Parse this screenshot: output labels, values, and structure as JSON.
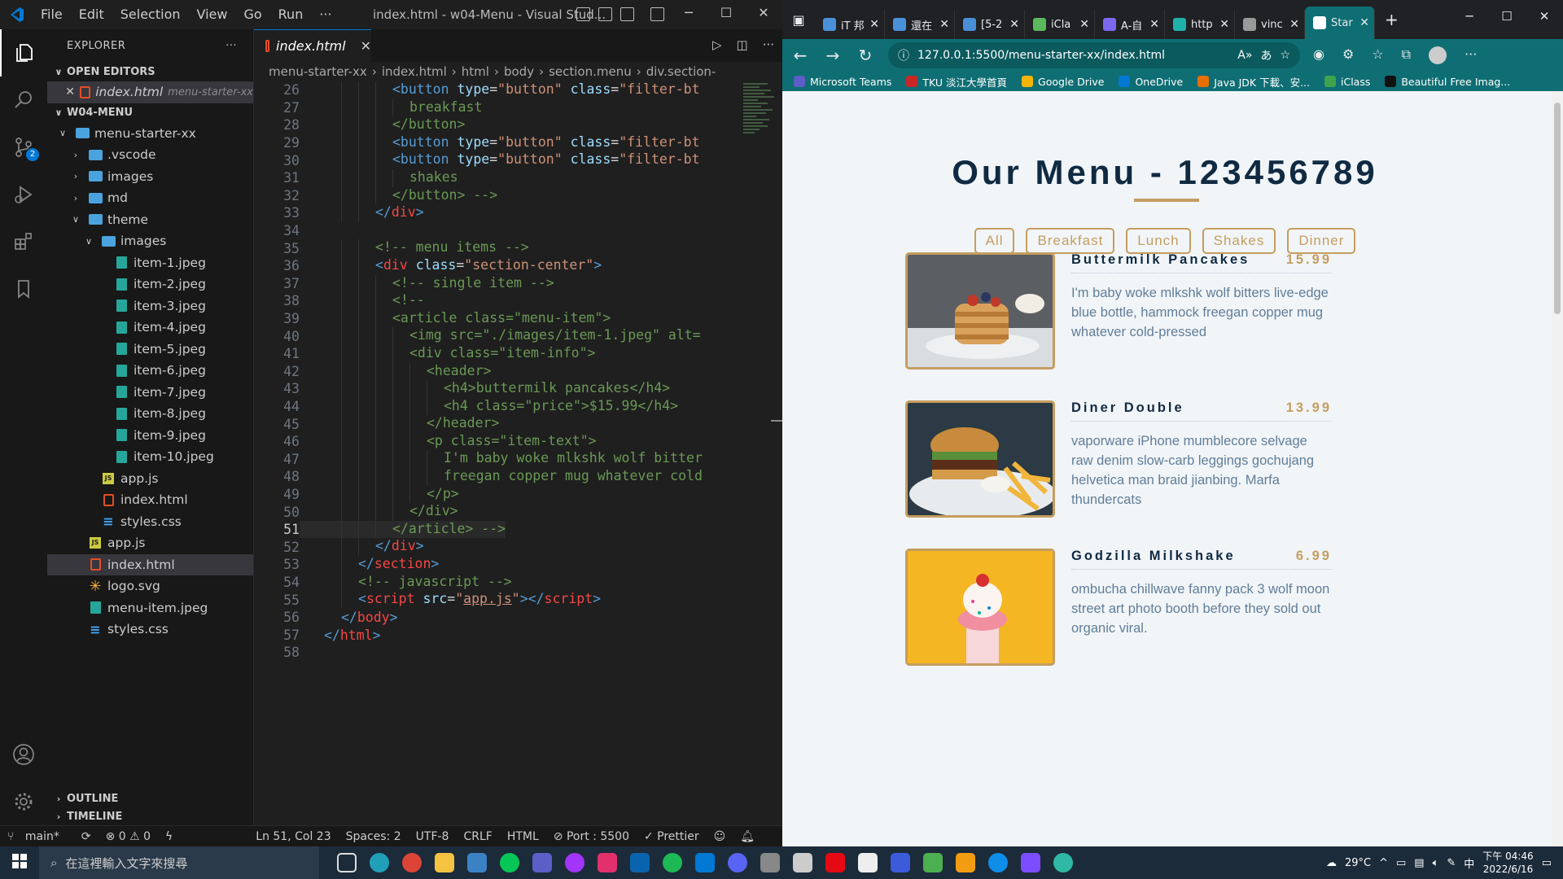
{
  "vscode": {
    "menu": [
      "File",
      "Edit",
      "Selection",
      "View",
      "Go",
      "Run",
      "···"
    ],
    "window_title": "index.html - w04-Menu - Visual Stud...",
    "explorer_title": "EXPLORER",
    "explorer_more": "···",
    "source_control_badge": "2",
    "open_editors_label": "OPEN EDITORS",
    "open_editor": {
      "name": "index.html",
      "path": "menu-starter-xx"
    },
    "workspace_label": "W04-MENU",
    "tree": [
      {
        "label": "menu-starter-xx",
        "type": "folder-open",
        "depth": 1
      },
      {
        "label": ".vscode",
        "type": "folder",
        "depth": 2
      },
      {
        "label": "images",
        "type": "folder",
        "depth": 2
      },
      {
        "label": "md",
        "type": "folder",
        "depth": 2
      },
      {
        "label": "theme",
        "type": "folder-open",
        "depth": 2
      },
      {
        "label": "images",
        "type": "folder-open",
        "depth": 3
      },
      {
        "label": "item-1.jpeg",
        "type": "image",
        "depth": 4
      },
      {
        "label": "item-2.jpeg",
        "type": "image",
        "depth": 4
      },
      {
        "label": "item-3.jpeg",
        "type": "image",
        "depth": 4
      },
      {
        "label": "item-4.jpeg",
        "type": "image",
        "depth": 4
      },
      {
        "label": "item-5.jpeg",
        "type": "image",
        "depth": 4
      },
      {
        "label": "item-6.jpeg",
        "type": "image",
        "depth": 4
      },
      {
        "label": "item-7.jpeg",
        "type": "image",
        "depth": 4
      },
      {
        "label": "item-8.jpeg",
        "type": "image",
        "depth": 4
      },
      {
        "label": "item-9.jpeg",
        "type": "image",
        "depth": 4
      },
      {
        "label": "item-10.jpeg",
        "type": "image",
        "depth": 4
      },
      {
        "label": "app.js",
        "type": "js",
        "depth": 3
      },
      {
        "label": "index.html",
        "type": "html",
        "depth": 3
      },
      {
        "label": "styles.css",
        "type": "css",
        "depth": 3
      },
      {
        "label": "app.js",
        "type": "js",
        "depth": 2
      },
      {
        "label": "index.html",
        "type": "html",
        "depth": 2,
        "selected": true
      },
      {
        "label": "logo.svg",
        "type": "svg",
        "depth": 2
      },
      {
        "label": "menu-item.jpeg",
        "type": "image",
        "depth": 2
      },
      {
        "label": "styles.css",
        "type": "css",
        "depth": 2
      }
    ],
    "outline_label": "OUTLINE",
    "timeline_label": "TIMELINE",
    "tab_label": "index.html",
    "breadcrumb": [
      "menu-starter-xx",
      "index.html",
      "html",
      "body",
      "section.menu",
      "div.section-"
    ],
    "current_line": 51,
    "code_lines": [
      {
        "n": 26,
        "html": "<span class='ind-c'></span><span class='ind'></span><span class='ind'></span><span class='ind'></span><span class='tg'>&lt;button</span> <span class='at'>type</span>=<span class='st'>\"button\"</span> <span class='at'>class</span>=<span class='st'>\"filter-bt</span>"
      },
      {
        "n": 27,
        "html": "<span class='ind-c'></span><span class='ind'></span><span class='ind'></span><span class='ind'></span><span class='ind'></span><span class='cm'>breakfast</span>"
      },
      {
        "n": 28,
        "html": "<span class='ind-c'></span><span class='ind'></span><span class='ind'></span><span class='ind'></span><span class='cm'>&lt;/button&gt;</span>"
      },
      {
        "n": 29,
        "html": "<span class='ind-c'></span><span class='ind'></span><span class='ind'></span><span class='ind'></span><span class='tg'>&lt;button</span> <span class='at'>type</span>=<span class='st'>\"button\"</span> <span class='at'>class</span>=<span class='st'>\"filter-bt</span>"
      },
      {
        "n": 30,
        "html": "<span class='ind-c'></span><span class='ind'></span><span class='ind'></span><span class='ind'></span><span class='tg'>&lt;button</span> <span class='at'>type</span>=<span class='st'>\"button\"</span> <span class='at'>class</span>=<span class='st'>\"filter-bt</span>"
      },
      {
        "n": 31,
        "html": "<span class='ind-c'></span><span class='ind'></span><span class='ind'></span><span class='ind'></span><span class='ind'></span><span class='cm'>shakes</span>"
      },
      {
        "n": 32,
        "html": "<span class='ind-c'></span><span class='ind'></span><span class='ind'></span><span class='ind'></span><span class='cm'>&lt;/button&gt; --&gt;</span>"
      },
      {
        "n": 33,
        "html": "<span class='ind-c'></span><span class='ind'></span><span class='ind'></span><span class='tg'>&lt;/</span><span class='tgr'>div</span><span class='tg'>&gt;</span>"
      },
      {
        "n": 34,
        "html": ""
      },
      {
        "n": 35,
        "html": "<span class='ind-c'></span><span class='ind'></span><span class='ind'></span><span class='cm'>&lt;!-- menu items --&gt;</span>"
      },
      {
        "n": 36,
        "html": "<span class='ind-c'></span><span class='ind'></span><span class='ind'></span><span class='tg'>&lt;</span><span class='tgr'>div</span> <span class='at'>class</span>=<span class='st'>\"section-center\"</span><span class='tg'>&gt;</span>"
      },
      {
        "n": 37,
        "html": "<span class='ind-c'></span><span class='ind'></span><span class='ind'></span><span class='ind'></span><span class='cm'>&lt;!-- single item --&gt;</span>"
      },
      {
        "n": 38,
        "html": "<span class='ind-c'></span><span class='ind'></span><span class='ind'></span><span class='ind'></span><span class='cm'>&lt;!--</span>"
      },
      {
        "n": 39,
        "html": "<span class='ind-c'></span><span class='ind'></span><span class='ind'></span><span class='ind'></span><span class='cm'>&lt;article class=\"menu-item\"&gt;</span>"
      },
      {
        "n": 40,
        "html": "<span class='ind-c'></span><span class='ind'></span><span class='ind'></span><span class='ind'></span><span class='ind'></span><span class='cm'>&lt;img src=\"./images/item-1.jpeg\" alt=</span>"
      },
      {
        "n": 41,
        "html": "<span class='ind-c'></span><span class='ind'></span><span class='ind'></span><span class='ind'></span><span class='ind'></span><span class='cm'>&lt;div class=\"item-info\"&gt;</span>"
      },
      {
        "n": 42,
        "html": "<span class='ind-c'></span><span class='ind'></span><span class='ind'></span><span class='ind'></span><span class='ind'></span><span class='ind'></span><span class='cm'>&lt;header&gt;</span>"
      },
      {
        "n": 43,
        "html": "<span class='ind-c'></span><span class='ind'></span><span class='ind'></span><span class='ind'></span><span class='ind'></span><span class='ind'></span><span class='ind'></span><span class='cm'>&lt;h4&gt;buttermilk pancakes&lt;/h4&gt;</span>"
      },
      {
        "n": 44,
        "html": "<span class='ind-c'></span><span class='ind'></span><span class='ind'></span><span class='ind'></span><span class='ind'></span><span class='ind'></span><span class='ind'></span><span class='cm'>&lt;h4 class=\"price\"&gt;$15.99&lt;/h4&gt;</span>"
      },
      {
        "n": 45,
        "html": "<span class='ind-c'></span><span class='ind'></span><span class='ind'></span><span class='ind'></span><span class='ind'></span><span class='ind'></span><span class='cm'>&lt;/header&gt;</span>"
      },
      {
        "n": 46,
        "html": "<span class='ind-c'></span><span class='ind'></span><span class='ind'></span><span class='ind'></span><span class='ind'></span><span class='ind'></span><span class='cm'>&lt;p class=\"item-text\"&gt;</span>"
      },
      {
        "n": 47,
        "html": "<span class='ind-c'></span><span class='ind'></span><span class='ind'></span><span class='ind'></span><span class='ind'></span><span class='ind'></span><span class='ind'></span><span class='cm'>I'm baby woke mlkshk wolf bitter</span>"
      },
      {
        "n": 48,
        "html": "<span class='ind-c'></span><span class='ind'></span><span class='ind'></span><span class='ind'></span><span class='ind'></span><span class='ind'></span><span class='ind'></span><span class='cm'>freegan copper mug whatever cold</span>"
      },
      {
        "n": 49,
        "html": "<span class='ind-c'></span><span class='ind'></span><span class='ind'></span><span class='ind'></span><span class='ind'></span><span class='ind'></span><span class='cm'>&lt;/p&gt;</span>"
      },
      {
        "n": 50,
        "html": "<span class='ind-c'></span><span class='ind'></span><span class='ind'></span><span class='ind'></span><span class='ind'></span><span class='cm'>&lt;/div&gt;</span>"
      },
      {
        "n": 51,
        "html": "<span class='ind-c'></span><span class='ind'></span><span class='ind'></span><span class='ind'></span><span class='cm'>&lt;/article&gt; --&gt;</span>"
      },
      {
        "n": 52,
        "html": "<span class='ind-c'></span><span class='ind'></span><span class='ind'></span><span class='tg'>&lt;/</span><span class='tgr'>div</span><span class='tg'>&gt;</span>"
      },
      {
        "n": 53,
        "html": "<span class='ind-c'></span><span class='ind'></span><span class='tg'>&lt;/</span><span class='tgr'>section</span><span class='tg'>&gt;</span>"
      },
      {
        "n": 54,
        "html": "<span class='ind-c'></span><span class='ind'></span><span class='cm'>&lt;!-- javascript --&gt;</span>"
      },
      {
        "n": 55,
        "html": "<span class='ind-c'></span><span class='ind'></span><span class='tg'>&lt;</span><span class='tgr'>script</span> <span class='at'>src</span>=<span class='st'>\"<u>app.js</u>\"</span><span class='tg'>&gt;&lt;/</span><span class='tgr'>script</span><span class='tg'>&gt;</span>"
      },
      {
        "n": 56,
        "html": "<span class='ind-c'></span><span class='tg'>&lt;/</span><span class='tgr'>body</span><span class='tg'>&gt;</span>"
      },
      {
        "n": 57,
        "html": "<span class='tg'>&lt;/</span><span class='tgr'>html</span><span class='tg'>&gt;</span>"
      },
      {
        "n": 58,
        "html": ""
      }
    ],
    "status": {
      "branch": "main*",
      "problems": "⊗ 0 ⚠ 0",
      "cursor": "Ln 51, Col 23",
      "spaces": "Spaces: 2",
      "encoding": "UTF-8",
      "eol": "CRLF",
      "language": "HTML",
      "port": "⊘ Port : 5500",
      "prettier": "✓ Prettier"
    }
  },
  "browser": {
    "tabs": [
      {
        "label": "iT 邦",
        "color": "#4a90d9"
      },
      {
        "label": "還在",
        "color": "#4a90d9"
      },
      {
        "label": "[5-2",
        "color": "#4a90d9"
      },
      {
        "label": "iCla",
        "color": "#5cb85c"
      },
      {
        "label": "A-自",
        "color": "#7b68ee"
      },
      {
        "label": "http",
        "color": "#20b2aa"
      },
      {
        "label": "vinc",
        "color": "#999999"
      },
      {
        "label": "Star",
        "color": "#ffffff",
        "active": true
      }
    ],
    "url": "127.0.0.1:5500/menu-starter-xx/index.html",
    "bookmarks": [
      {
        "label": "Microsoft Teams",
        "color": "#5b5fc7"
      },
      {
        "label": "TKU 淡江大學首頁",
        "color": "#c62828"
      },
      {
        "label": "Google Drive",
        "color": "#f4b400"
      },
      {
        "label": "OneDrive",
        "color": "#0078d4"
      },
      {
        "label": "Java JDK 下載、安...",
        "color": "#e76f00"
      },
      {
        "label": "iClass",
        "color": "#3fa34d"
      },
      {
        "label": "Beautiful Free Imag...",
        "color": "#111111"
      }
    ],
    "page": {
      "title": "Our Menu - 123456789",
      "filters": [
        "All",
        "Breakfast",
        "Lunch",
        "Shakes",
        "Dinner"
      ],
      "items": [
        {
          "name": "Buttermilk Pancakes",
          "price": "15.99",
          "text": "I'm baby woke mlkshk wolf bitters live-edge blue bottle, hammock freegan copper mug whatever cold-pressed",
          "photo": "pancakes"
        },
        {
          "name": "Diner Double",
          "price": "13.99",
          "text": "vaporware iPhone mumblecore selvage raw denim slow-carb leggings gochujang helvetica man braid jianbing. Marfa thundercats",
          "photo": "burger"
        },
        {
          "name": "Godzilla Milkshake",
          "price": "6.99",
          "text": "ombucha chillwave fanny pack 3 wolf moon street art photo booth before they sold out organic viral.",
          "photo": "milkshake"
        }
      ]
    }
  },
  "taskbar": {
    "search_placeholder": "在這裡輸入文字來搜尋",
    "temperature": "29°C",
    "ime": "中",
    "time": "下午 04:46",
    "date": "2022/6/16"
  }
}
